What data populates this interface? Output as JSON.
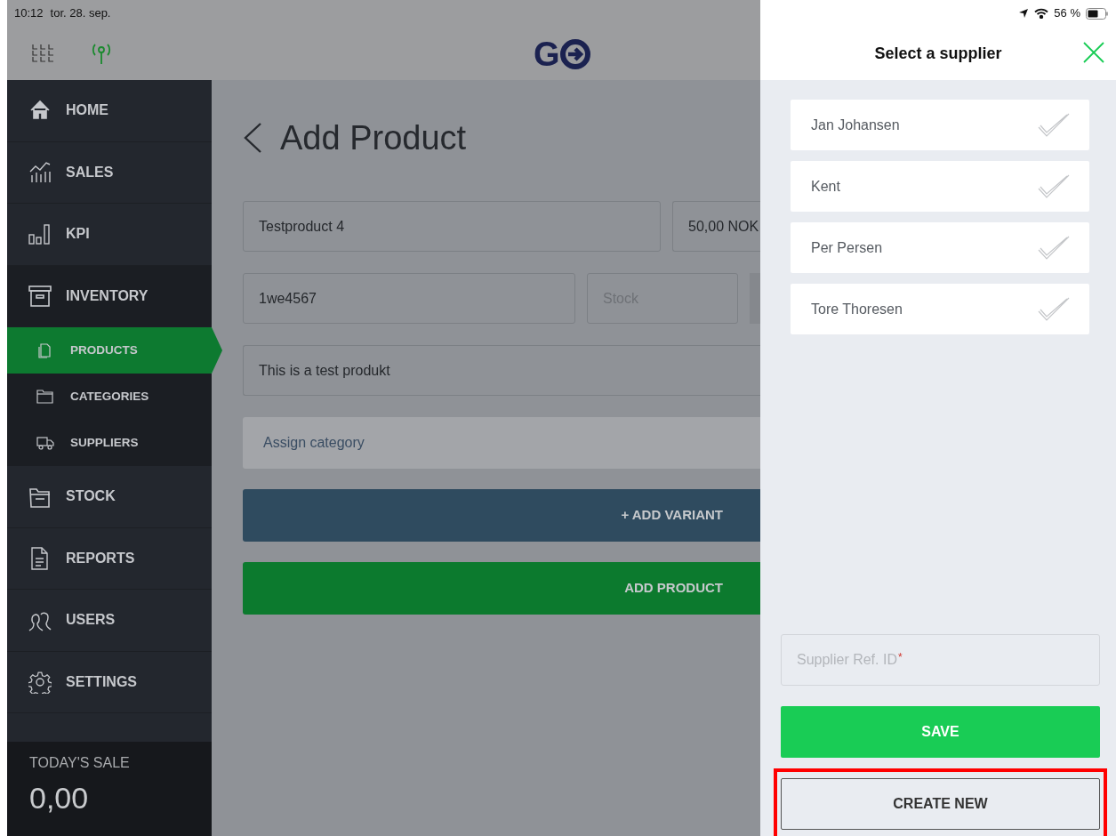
{
  "status_bar": {
    "time": "10:12",
    "date": "tor. 28. sep.",
    "battery": "56 %"
  },
  "header": {
    "logo_letter": "G"
  },
  "sidebar": {
    "items": [
      {
        "label": "HOME",
        "selected": false
      },
      {
        "label": "SALES",
        "selected": false
      },
      {
        "label": "KPI",
        "selected": false
      },
      {
        "label": "INVENTORY",
        "selected": false,
        "children": [
          {
            "label": "PRODUCTS",
            "selected": true
          },
          {
            "label": "CATEGORIES",
            "selected": false
          },
          {
            "label": "SUPPLIERS",
            "selected": false
          }
        ]
      },
      {
        "label": "STOCK",
        "selected": false
      },
      {
        "label": "REPORTS",
        "selected": false
      },
      {
        "label": "USERS",
        "selected": false
      },
      {
        "label": "SETTINGS",
        "selected": false
      }
    ],
    "todays_sale": {
      "label": "TODAY'S SALE",
      "value": "0,00"
    }
  },
  "page": {
    "title": "Add Product",
    "rows": [
      [
        {
          "value": "Testproduct 4"
        },
        {
          "value": "50,00 NOK"
        }
      ],
      [
        {
          "value": "1we4567"
        },
        {
          "placeholder": "Stock"
        }
      ],
      [
        {
          "value": "This is a test produkt"
        }
      ]
    ],
    "category_select": {
      "label": "Assign category"
    },
    "buttons": [
      {
        "kind": "variant",
        "label": "+ ADD VARIANT"
      },
      {
        "kind": "primary",
        "label": "ADD PRODUCT"
      }
    ]
  },
  "supplier_panel": {
    "title": "Select a supplier",
    "suppliers": [
      {
        "name": "Jan Johansen",
        "selected": false
      },
      {
        "name": "Kent",
        "selected": false
      },
      {
        "name": "Per Persen",
        "selected": false
      },
      {
        "name": "Tore Thoresen",
        "selected": false
      }
    ],
    "ref_field": {
      "placeholder": "Supplier Ref. ID",
      "required_mark": "*"
    },
    "buttons": [
      {
        "kind": "save",
        "label": "SAVE",
        "highlighted": false
      },
      {
        "kind": "create",
        "label": "CREATE NEW",
        "highlighted": true
      }
    ]
  }
}
